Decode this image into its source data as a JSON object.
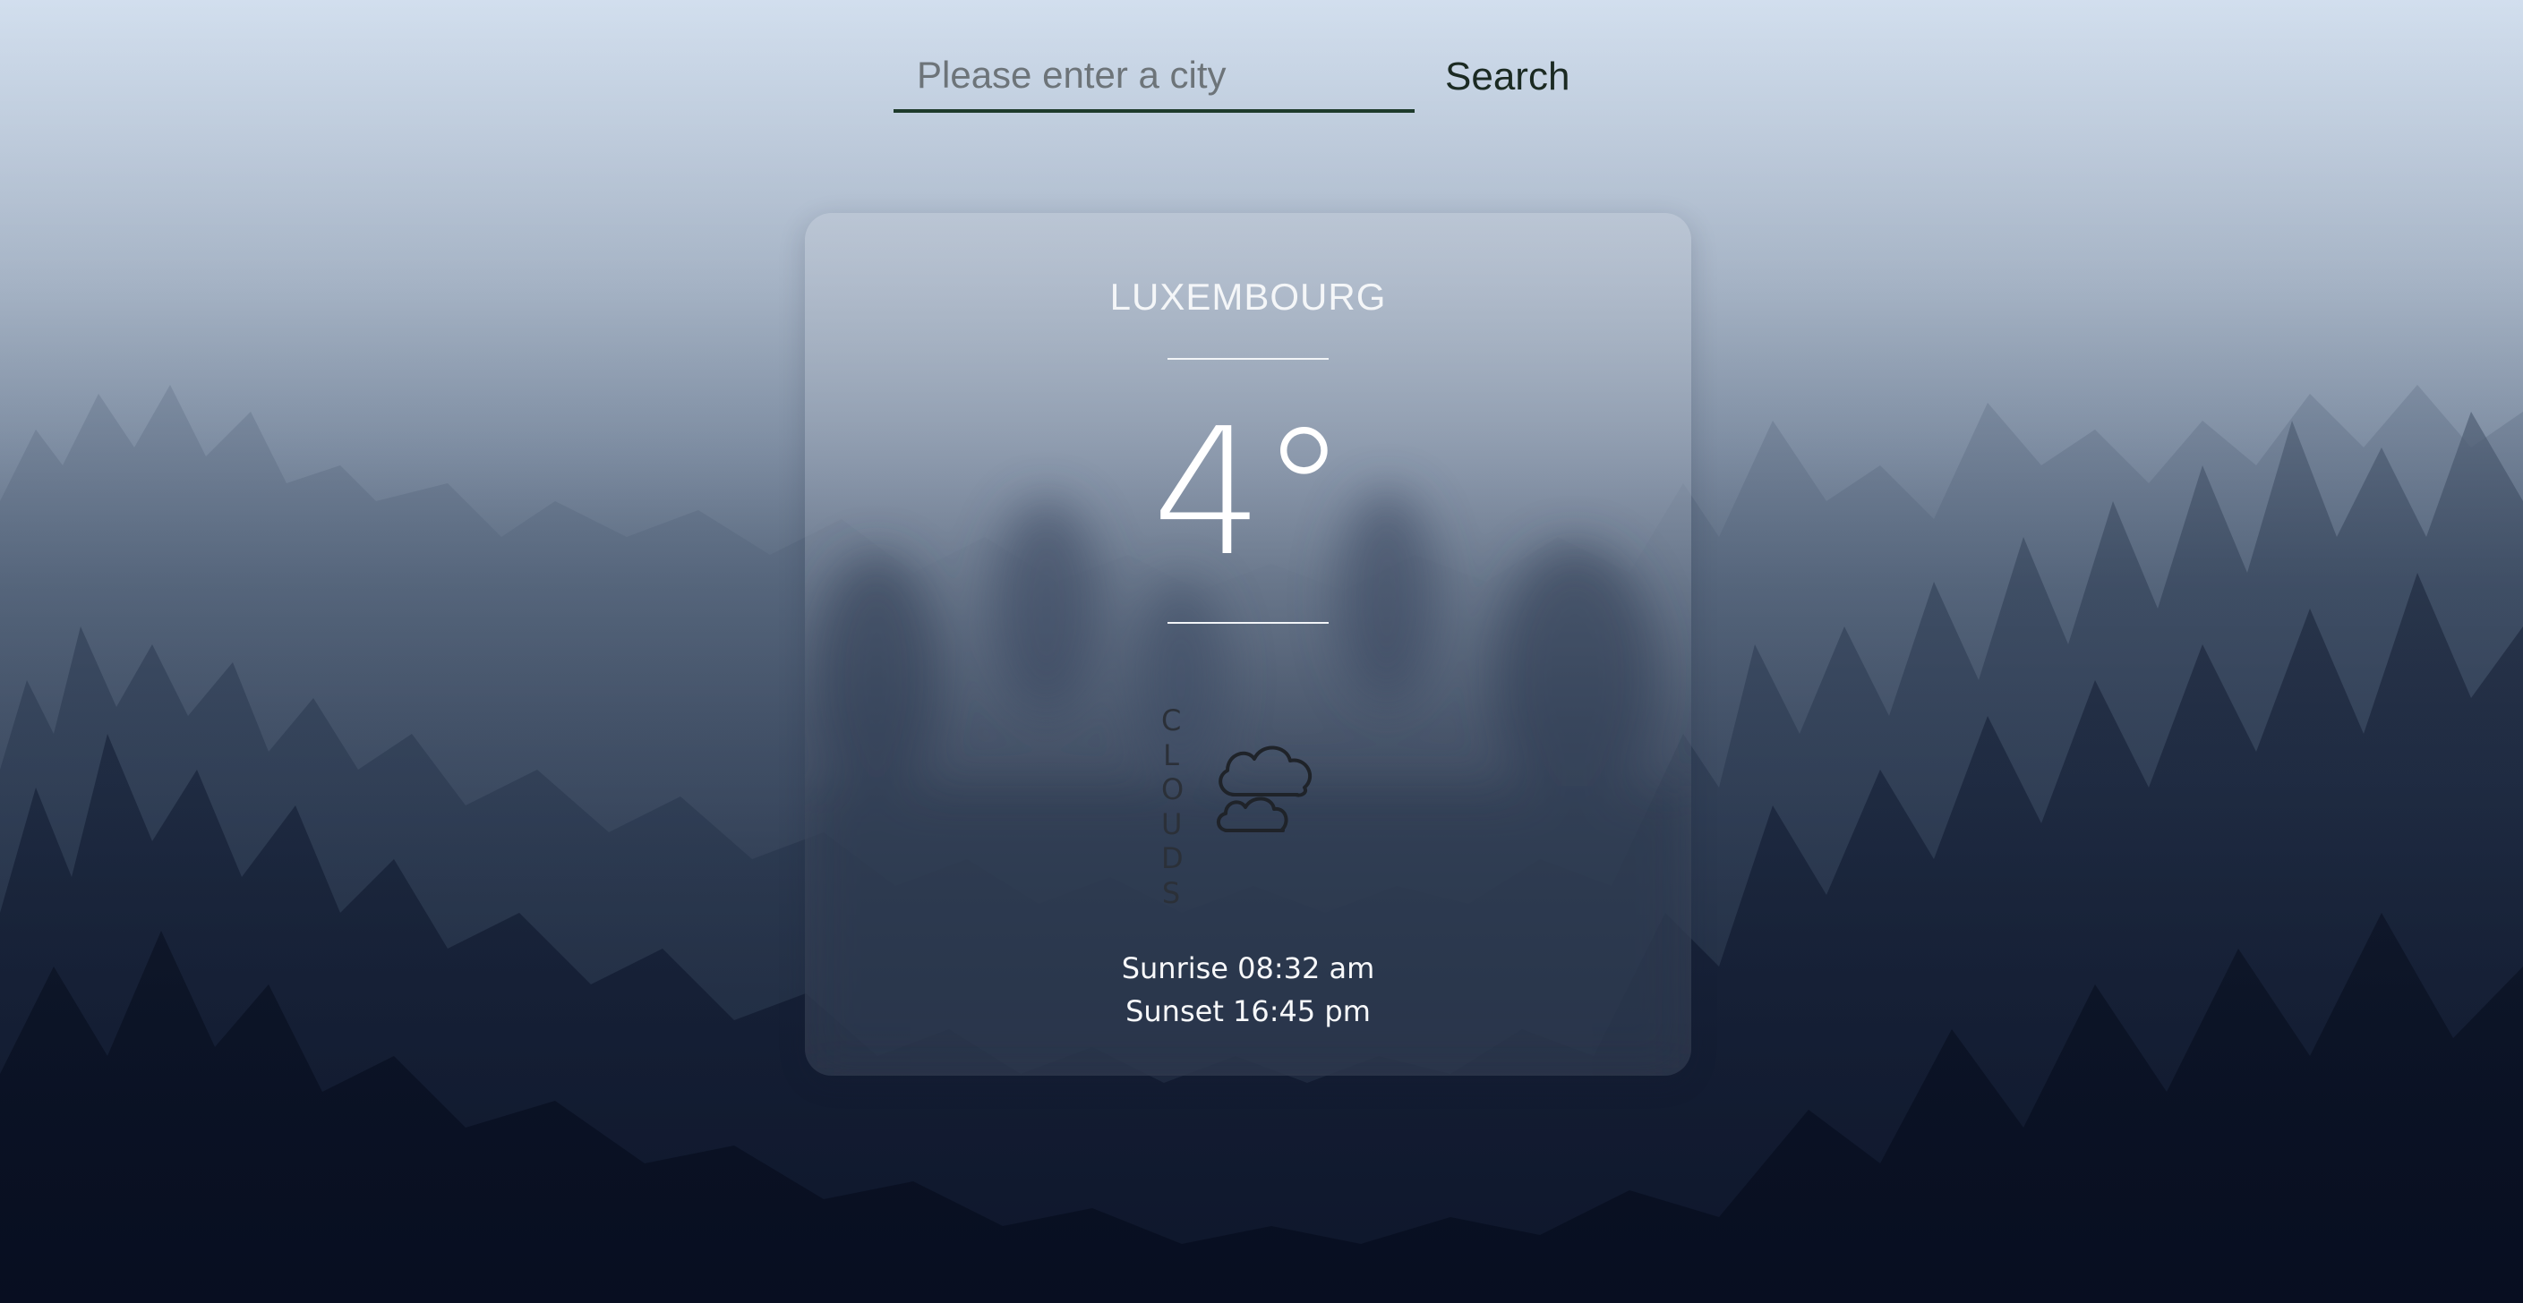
{
  "search": {
    "placeholder": "Please enter a city",
    "value": "",
    "button_label": "Search"
  },
  "weather": {
    "city": "LUXEMBOURG",
    "temperature": "4°",
    "condition": "CLOUDS",
    "icon": "clouds-icon",
    "sunrise": "Sunrise 08:32 am",
    "sunset": "Sunset 16:45 pm"
  },
  "colors": {
    "card_text": "#ffffff",
    "condition_text": "#2b3038",
    "input_underline": "#1e3a2b"
  }
}
